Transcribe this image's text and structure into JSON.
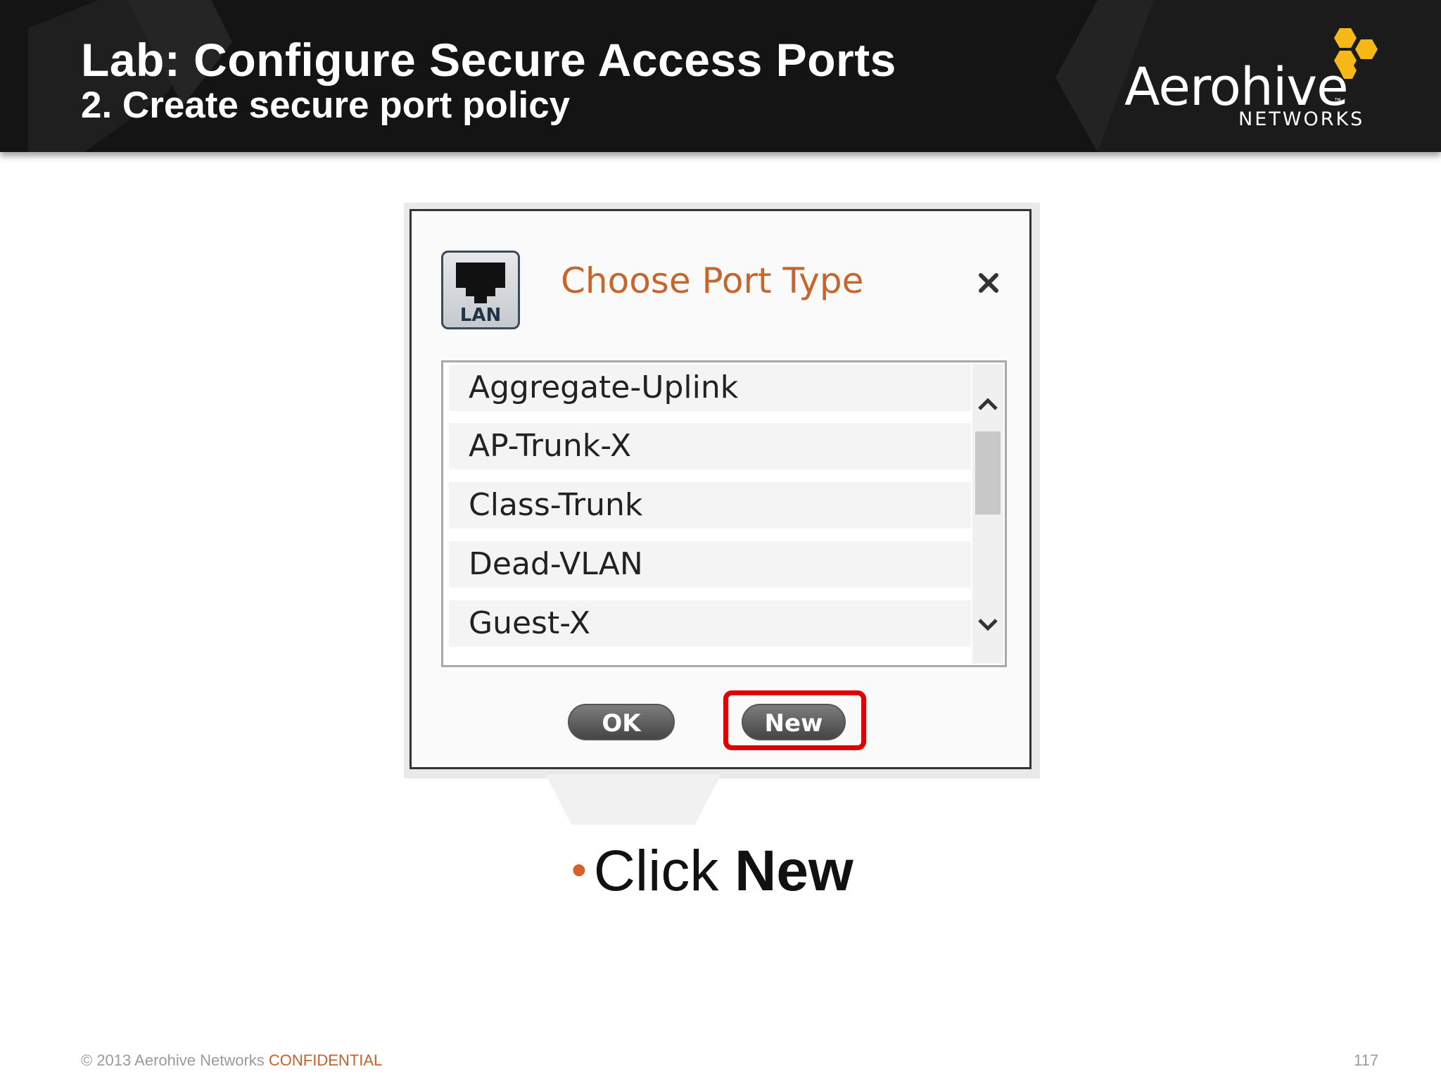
{
  "header": {
    "title": "Lab: Configure Secure Access Ports",
    "subtitle": "2. Create secure port policy"
  },
  "logo": {
    "wordmark": "Aerohive",
    "tm": "™",
    "networks": "NETWORKS",
    "hex_color": "#f5b817"
  },
  "dialog": {
    "icon_label": "LAN",
    "title": "Choose Port Type",
    "title_color": "#c6652c",
    "close_icon": "close-icon",
    "items": [
      {
        "label": "Aggregate-Uplink"
      },
      {
        "label": "AP-Trunk-X"
      },
      {
        "label": "Class-Trunk"
      },
      {
        "label": "Dead-VLAN"
      },
      {
        "label": "Guest-X"
      }
    ],
    "ok_label": "OK",
    "new_label": "New",
    "highlight_color": "#e00000"
  },
  "bullet": {
    "prefix": "Click ",
    "emphasis": "New"
  },
  "footer": {
    "copyright": "© 2013 Aerohive Networks ",
    "confidential": "CONFIDENTIAL",
    "page_number": "117"
  }
}
